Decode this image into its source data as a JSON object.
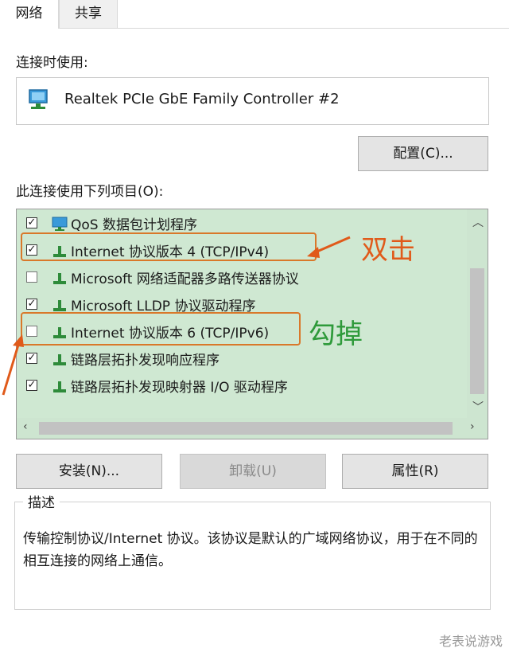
{
  "tabs": [
    {
      "label": "网络",
      "active": true
    },
    {
      "label": "共享",
      "active": false
    }
  ],
  "connect_using_label": "连接时使用:",
  "adapter": {
    "icon": "network-adapter-icon",
    "name": "Realtek PCIe GbE Family Controller #2"
  },
  "configure_button": "配置(C)...",
  "items_label": "此连接使用下列项目(O):",
  "items": [
    {
      "label": "QoS 数据包计划程序",
      "checked": true,
      "icon": "monitor-icon"
    },
    {
      "label": "Internet 协议版本 4 (TCP/IPv4)",
      "checked": true,
      "icon": "protocol-icon"
    },
    {
      "label": "Microsoft 网络适配器多路传送器协议",
      "checked": false,
      "icon": "protocol-icon"
    },
    {
      "label": "Microsoft LLDP 协议驱动程序",
      "checked": true,
      "icon": "protocol-icon"
    },
    {
      "label": "Internet 协议版本 6 (TCP/IPv6)",
      "checked": false,
      "icon": "protocol-icon"
    },
    {
      "label": "链路层拓扑发现响应程序",
      "checked": true,
      "icon": "protocol-icon"
    },
    {
      "label": "链路层拓扑发现映射器 I/O 驱动程序",
      "checked": true,
      "icon": "protocol-icon"
    }
  ],
  "annotations": {
    "double_click": "双击",
    "uncheck": "勾掉",
    "double_click_color": "#e05a1a",
    "uncheck_color": "#2e9a3a",
    "highlight_color": "#d9782a"
  },
  "buttons": {
    "install": "安装(N)...",
    "uninstall": "卸载(U)",
    "properties": "属性(R)"
  },
  "description": {
    "legend": "描述",
    "text": "传输控制协议/Internet 协议。该协议是默认的广域网络协议，用于在不同的相互连接的网络上通信。"
  },
  "watermark": "老表说游戏",
  "colors": {
    "list_bg": "#cfe8d2",
    "protocol_icon": "#2e8b3a"
  }
}
